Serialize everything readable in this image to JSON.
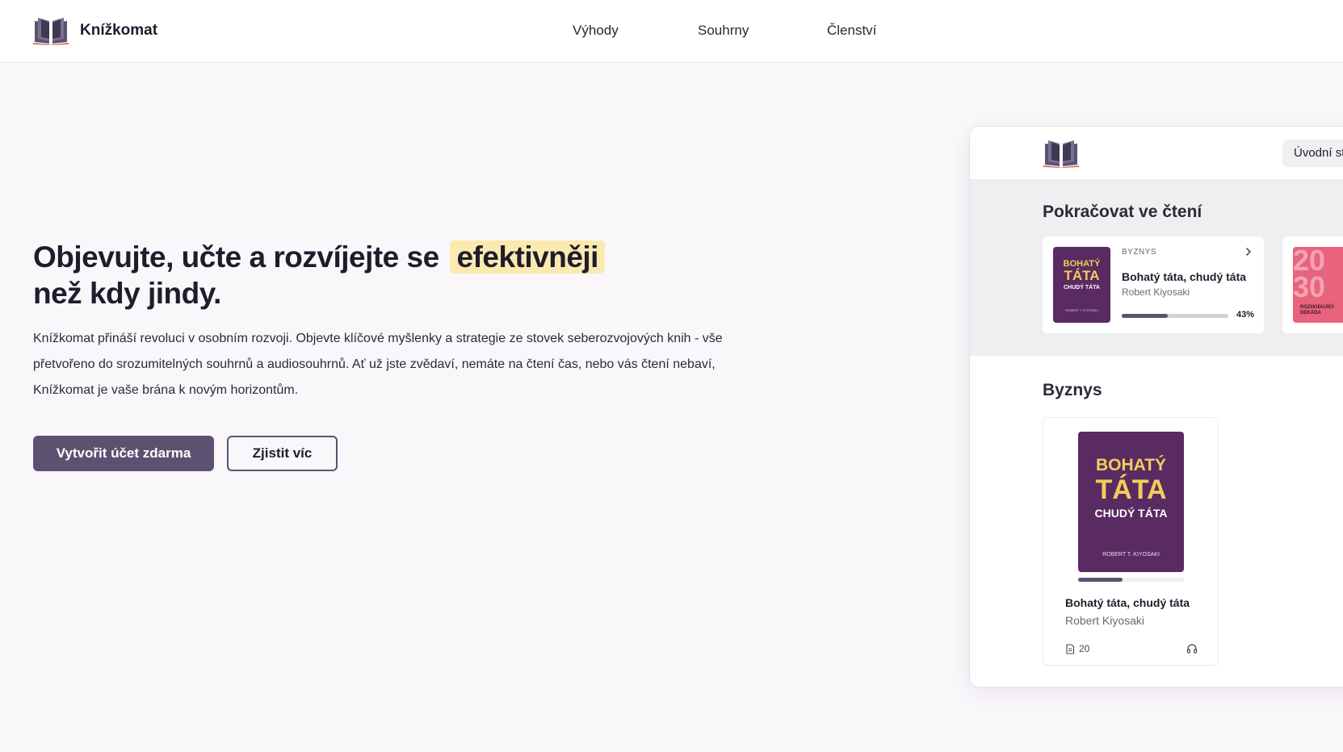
{
  "brand": {
    "name": "Knížkomat",
    "logo_icon": "open-book-icon"
  },
  "nav": {
    "items": [
      "Výhody",
      "Souhrny",
      "Členství"
    ]
  },
  "hero": {
    "title_part1": "Objevujte, učte a rozvíjejte se",
    "title_highlight": "efektivněji",
    "title_line2": "než kdy jindy.",
    "description": "Knížkomat přináší revoluci v osobním rozvoji. Objevte klíčové myšlenky a strategie ze stovek seberozvojových knih - vše přetvořeno do srozumitelných souhrnů a audiosouhrnů. Ať už jste zvědaví, nemáte na čtení čas, nebo vás čtení nebaví, Knížkomat je vaše brána k novým horizontům.",
    "primary_button": "Vytvořit účet zdarma",
    "secondary_button": "Zjistit víc",
    "highlight_color": "#fbeab0",
    "accent_color": "#5b5272"
  },
  "preview": {
    "home_button": "Úvodní st",
    "continue_section": {
      "title": "Pokračovat ve čtení",
      "card": {
        "category": "BYZNYS",
        "title": "Bohatý táta, chudý táta",
        "author": "Robert Kiyosaki",
        "progress": 0.43,
        "progress_label": "43%",
        "cover": {
          "line1": "BOHATÝ",
          "line2": "TÁTA",
          "line3": "CHUDÝ TÁTA",
          "author": "ROBERT T. KIYOSAKI",
          "color": "#5a2a62"
        }
      },
      "peek_card": {
        "num1": "20",
        "num2": "30",
        "subtitle_line1": "ROZHODUJÍCÍ",
        "subtitle_line2": "DEKÁDA",
        "color": "#e8637c"
      }
    },
    "business_section": {
      "title": "Byznys",
      "book": {
        "title": "Bohatý táta, chudý táta",
        "author": "Robert Kiyosaki",
        "pages": "20",
        "progress": 0.42,
        "cover": {
          "line1": "BOHATÝ",
          "line2": "TÁTA",
          "line3": "CHUDÝ TÁTA",
          "author": "ROBERT T. KIYOSAKI"
        }
      }
    }
  }
}
